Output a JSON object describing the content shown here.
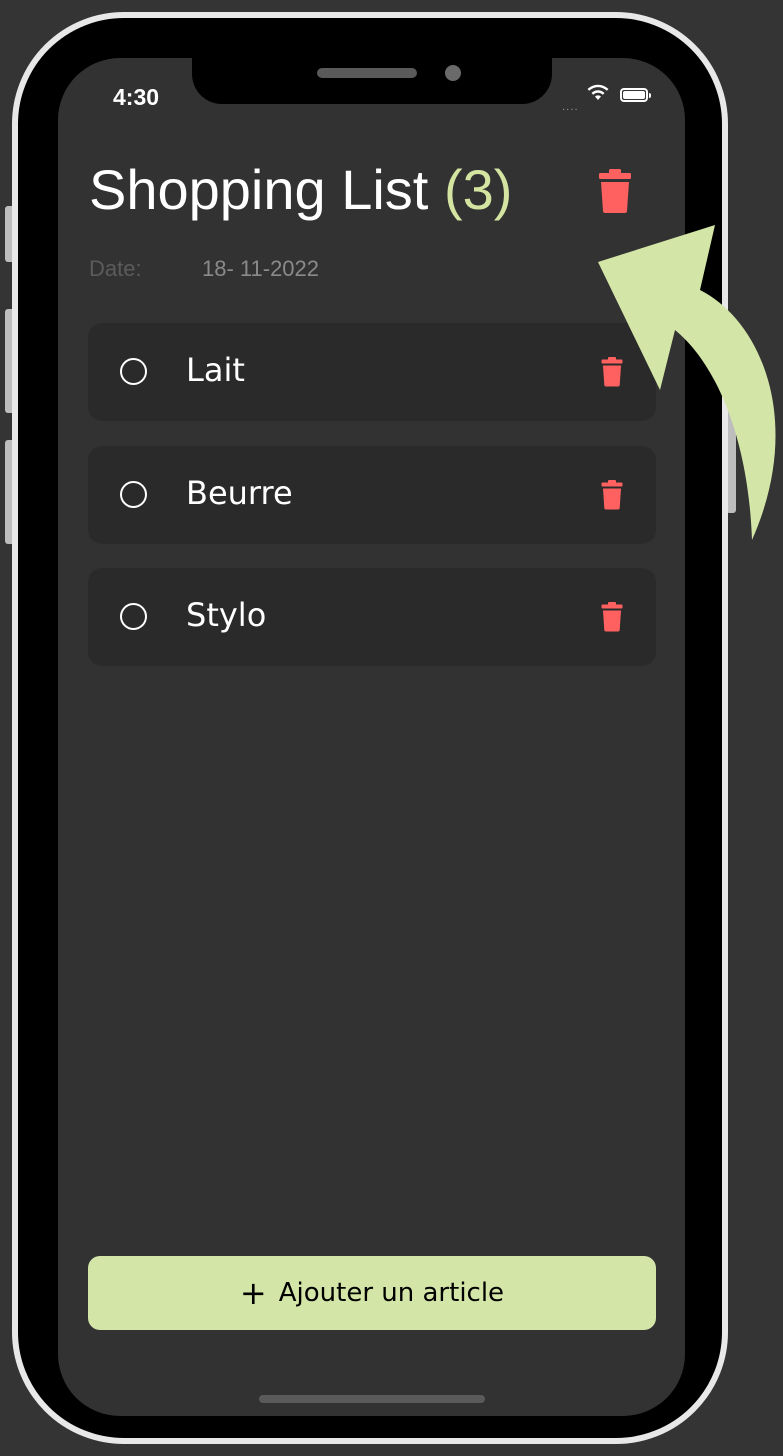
{
  "status_bar": {
    "time": "4:30",
    "signal": "....",
    "wifi_icon": "wifi-icon",
    "battery_icon": "battery-icon"
  },
  "header": {
    "title": "Shopping List",
    "count": "(3)",
    "delete_icon": "trash-icon",
    "date_label": "Date:",
    "date_value": "18- 11-2022"
  },
  "items": [
    {
      "label": "Lait",
      "checked": false
    },
    {
      "label": "Beurre",
      "checked": false
    },
    {
      "label": "Stylo",
      "checked": false
    }
  ],
  "add_button": {
    "icon": "+",
    "label": "Ajouter un article"
  },
  "colors": {
    "background": "#343434",
    "screen": "#323232",
    "card": "#2a2a2a",
    "accent": "#d4e5a2",
    "danger": "#ff6161",
    "arrow": "#d4e6a7"
  }
}
